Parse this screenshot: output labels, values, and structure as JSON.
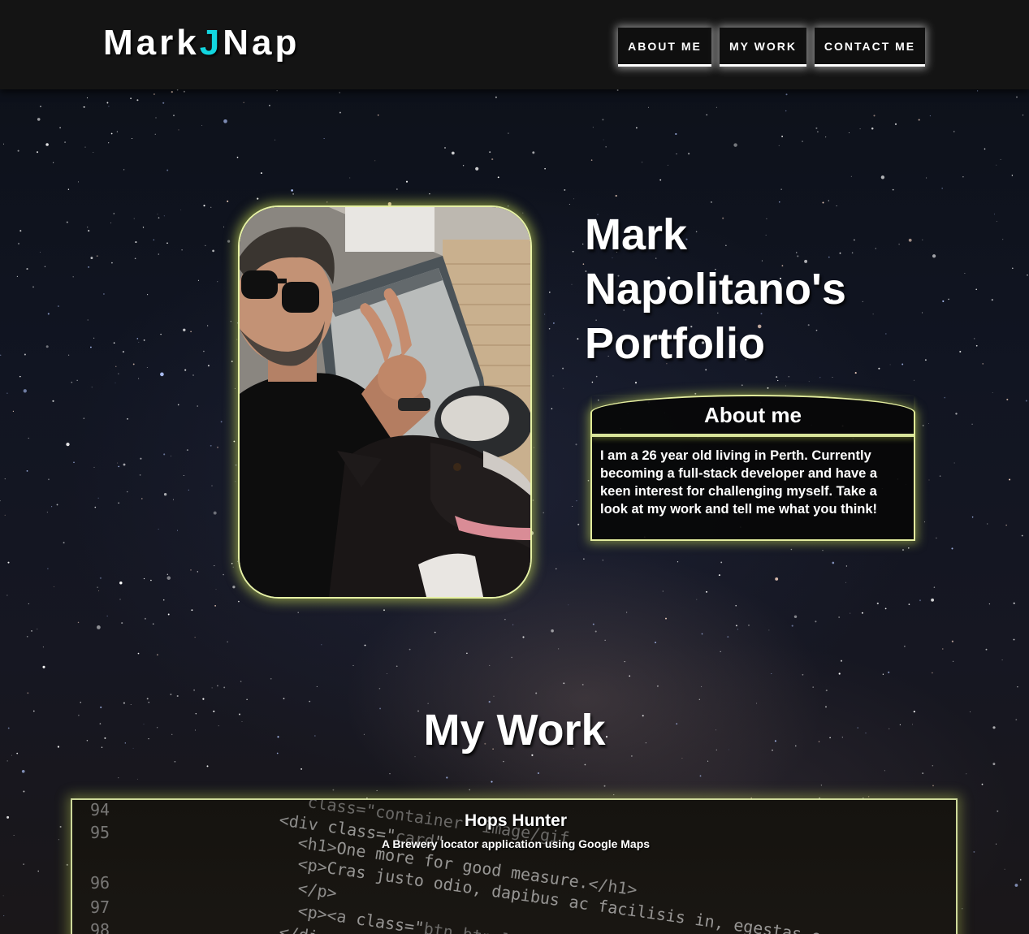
{
  "header": {
    "logo_part1": "Mark",
    "logo_part2": "J",
    "logo_part3": "Nap",
    "nav": [
      "ABOUT ME",
      "MY WORK",
      "CONTACT ME"
    ]
  },
  "hero": {
    "title": "Mark Napolitano's Portfolio",
    "photo_alt": "photo of Mark with his dog"
  },
  "about": {
    "heading": "About me",
    "text": "I am a 26 year old living in Perth. Currently becoming a full-stack developer and have a keen interest for challenging myself. Take a look at my work and tell me what you think!"
  },
  "work": {
    "heading": "My Work",
    "projects": [
      {
        "title": "Hops Hunter",
        "description": "A Brewery locator application using Google Maps"
      }
    ]
  },
  "colors": {
    "accent_cyan": "#12d6e0",
    "glow_yellow": "#d8e49a",
    "header_bg": "#141414"
  }
}
